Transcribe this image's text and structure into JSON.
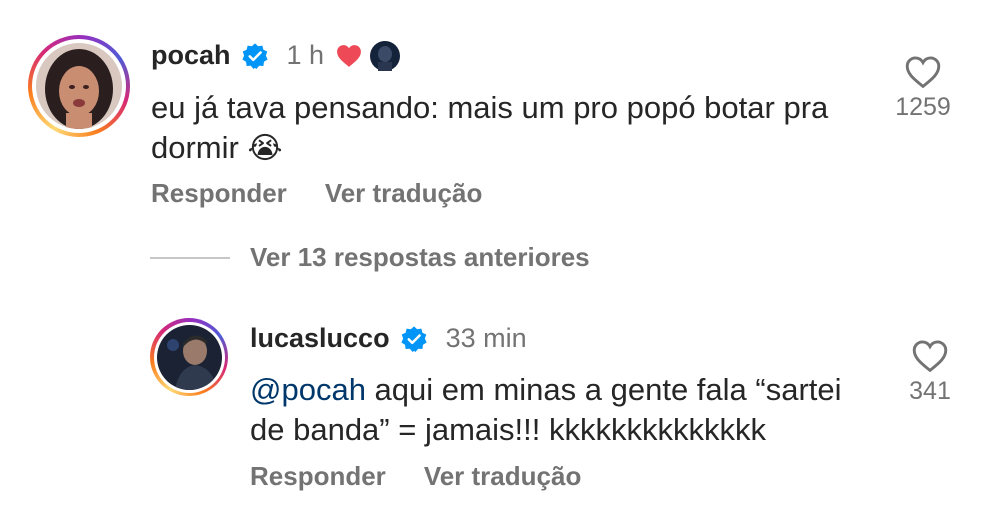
{
  "comment": {
    "username": "pocah",
    "time": "1 h",
    "text": "eu já tava pensando: mais um pro popó botar pra dormir",
    "emoji": "😭",
    "likes": "1259",
    "reply_label": "Responder",
    "translate_label": "Ver tradução"
  },
  "view_replies_label": "Ver 13 respostas anteriores",
  "reply": {
    "username": "lucaslucco",
    "time": "33 min",
    "mention": "@pocah",
    "text": " aqui em minas a gente fala “sartei de banda” = jamais!!! kkkkkkkkkkkkkk",
    "likes": "341",
    "reply_label": "Responder",
    "translate_label": "Ver tradução"
  },
  "colors": {
    "verified": "#0095f6",
    "heart": "#ed4956",
    "secondary_text": "#737373",
    "mention": "#00376b"
  },
  "icons": [
    "verified-badge-icon",
    "red-heart-icon",
    "author-avatar-icon",
    "like-heart-icon"
  ]
}
